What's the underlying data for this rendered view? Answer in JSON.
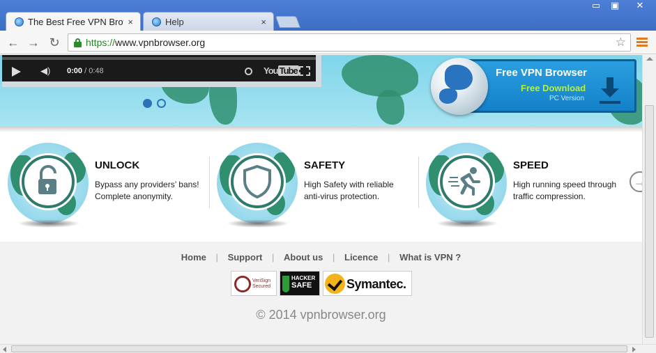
{
  "browser": {
    "tabs": [
      {
        "label": "The Best Free VPN Browser",
        "active": true
      },
      {
        "label": "Help",
        "active": false
      }
    ],
    "close_glyph": "×",
    "window_controls": {
      "minimize": "▭",
      "maximize": "▣",
      "close": "✕"
    },
    "nav": {
      "back": "←",
      "forward": "→",
      "reload": "↻"
    },
    "url_scheme": "https://",
    "url_host": "www.vpnbrowser.org",
    "bookmark_star": "☆"
  },
  "banner": {
    "video": {
      "current_time": "0:00",
      "duration": " / 0:48",
      "youtube_prefix": "You",
      "youtube_suffix": "Tube",
      "volume_glyph": "◀)"
    },
    "download": {
      "title": "Free VPN Browser",
      "subtitle": "Free Download",
      "version": "PC Version"
    }
  },
  "features": [
    {
      "title": "UNLOCK",
      "desc_line1": "Bypass any providers’ bans!",
      "desc_line2": "Complete anonymity.",
      "icon": "unlock-icon"
    },
    {
      "title": "SAFETY",
      "desc_line1": "High Safety with reliable",
      "desc_line2": "anti-virus protection.",
      "icon": "shield-icon"
    },
    {
      "title": "SPEED",
      "desc_line1": "High running speed through",
      "desc_line2": "traffic compression.",
      "icon": "runner-icon"
    }
  ],
  "next_arrow": "→",
  "footer": {
    "links": [
      "Home",
      "Support",
      "About us",
      "Licence",
      "What is VPN ?"
    ],
    "separator": "|",
    "badges": {
      "verisign_line1": "VeriSign",
      "verisign_line2": "Secured",
      "hacker_line1": "HACKER",
      "hacker_line2": "SAFE",
      "symantec": "Symantec."
    },
    "copyright": "© 2014 vpnbrowser.org"
  },
  "colors": {
    "accent_orange": "#e07b1a",
    "banner_blue": "#1481c8",
    "download_green": "#b6f23a",
    "land_green": "#2f8f6e"
  }
}
